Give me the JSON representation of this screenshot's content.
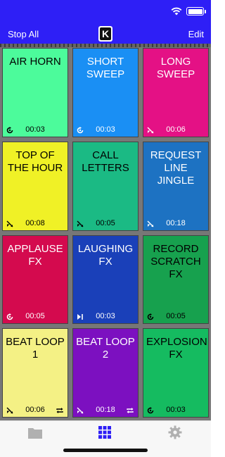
{
  "header": {
    "stop_all_label": "Stop All",
    "edit_label": "Edit",
    "logo_letter": "K",
    "bg_color": "#2e1ff6"
  },
  "pads": [
    {
      "label": "AIR HORN",
      "time": "00:03",
      "bg": "#4cfb9b",
      "fg": "#000000",
      "mode_icon": "restart-icon",
      "loop": false
    },
    {
      "label": "SHORT SWEEP",
      "time": "00:03",
      "bg": "#1a8ff4",
      "fg": "#ffffff",
      "mode_icon": "restart-icon",
      "loop": false
    },
    {
      "label": "LONG SWEEP",
      "time": "00:06",
      "bg": "#e41185",
      "fg": "#ffffff",
      "mode_icon": "fade-icon",
      "loop": false
    },
    {
      "label": "TOP OF THE HOUR",
      "time": "00:08",
      "bg": "#f0f126",
      "fg": "#000000",
      "mode_icon": "fade-icon",
      "loop": false
    },
    {
      "label": "CALL LETTERS",
      "time": "00:05",
      "bg": "#1bba84",
      "fg": "#000000",
      "mode_icon": "fade-icon",
      "loop": false
    },
    {
      "label": "REQUEST LINE JINGLE",
      "time": "00:18",
      "bg": "#1d72c2",
      "fg": "#ffffff",
      "mode_icon": "fade-icon",
      "loop": false
    },
    {
      "label": "APPLAUSE FX",
      "time": "00:05",
      "bg": "#d40a4e",
      "fg": "#ffffff",
      "mode_icon": "restart-icon",
      "loop": false
    },
    {
      "label": "LAUGHING FX",
      "time": "00:03",
      "bg": "#1a40b9",
      "fg": "#ffffff",
      "mode_icon": "play-stop-icon",
      "loop": false
    },
    {
      "label": "RECORD SCRATCH FX",
      "time": "00:05",
      "bg": "#17a14e",
      "fg": "#000000",
      "mode_icon": "restart-icon",
      "loop": false
    },
    {
      "label": "BEAT LOOP 1",
      "time": "00:06",
      "bg": "#f4f185",
      "fg": "#000000",
      "mode_icon": "fade-icon",
      "loop": true
    },
    {
      "label": "BEAT LOOP 2",
      "time": "00:18",
      "bg": "#7c10c0",
      "fg": "#ffffff",
      "mode_icon": "fade-icon",
      "loop": true
    },
    {
      "label": "EXPLOSION FX",
      "time": "00:03",
      "bg": "#15bb60",
      "fg": "#000000",
      "mode_icon": "restart-icon",
      "loop": false
    }
  ],
  "tabbar": {
    "tabs": [
      {
        "icon": "folder-icon",
        "active": false
      },
      {
        "icon": "grid-icon",
        "active": true
      },
      {
        "icon": "gear-icon",
        "active": false
      }
    ],
    "active_color": "#2e1ff6",
    "inactive_color": "#b0b0b0"
  }
}
